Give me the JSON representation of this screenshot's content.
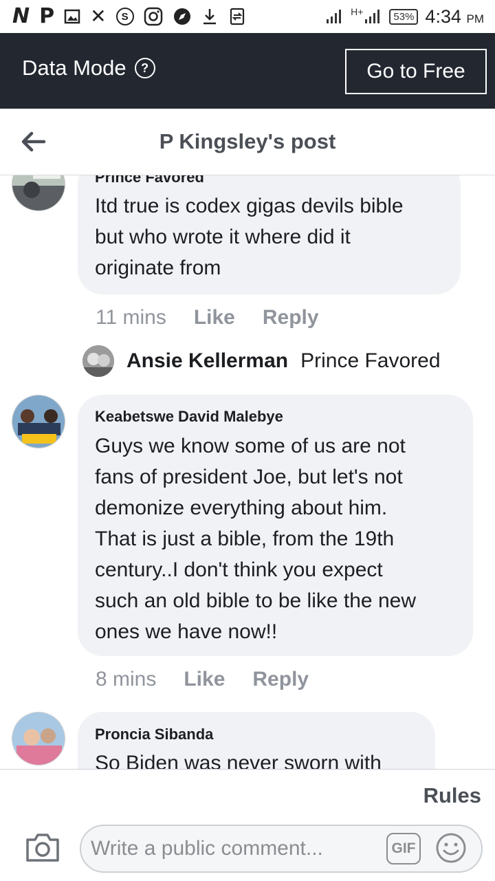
{
  "status_bar": {
    "icons": [
      "n-app-icon",
      "p-app-icon",
      "image-icon",
      "x-icon",
      "s-coin-icon",
      "instagram-icon",
      "compass-icon",
      "download-icon",
      "sync-icon"
    ],
    "network": "H+",
    "battery": "53%",
    "time": "4:34",
    "ampm": "PM"
  },
  "data_bar": {
    "label": "Data Mode",
    "help_icon": "?",
    "go_free_label": "Go to Free",
    "background": "#222730"
  },
  "header": {
    "title": "P Kingsley's post"
  },
  "comments": [
    {
      "author": "Prince Favored",
      "lines": [
        "Itd true is codex gigas devils bible",
        "but who wrote it where did it",
        "originate from"
      ],
      "time": "11 mins",
      "like": "Like",
      "reply": "Reply"
    },
    {
      "author": "Keabetswe David Malebye",
      "lines": [
        "Guys we know some of us are not",
        "fans of president Joe, but let's not",
        "demonize everything about him.",
        "That is just a bible, from the 19th",
        "century..I don't think you expect",
        "such an old bible to be like the new",
        "ones we have now!!"
      ],
      "time": "8 mins",
      "like": "Like",
      "reply": "Reply"
    },
    {
      "author": "Proncia Sibanda",
      "lines": [
        "So Biden was never sworn with"
      ]
    }
  ],
  "reply_preview": {
    "name": "Ansie Kellerman",
    "tag": "Prince Favored"
  },
  "composer": {
    "rules": "Rules",
    "placeholder": "Write a public comment...",
    "gif": "GIF"
  }
}
